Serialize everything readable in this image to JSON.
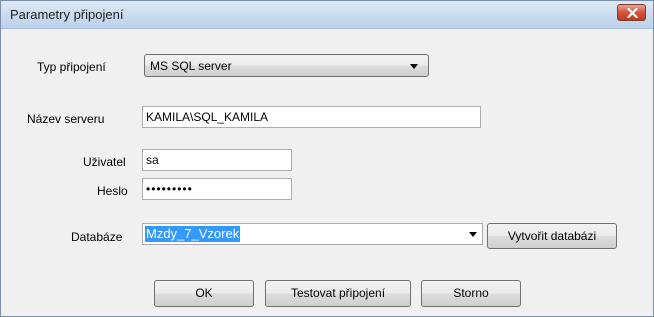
{
  "window": {
    "title": "Parametry připojení"
  },
  "form": {
    "connection_type_label": "Typ připojení",
    "connection_type_value": "MS SQL server",
    "server_name_label": "Název serveru",
    "server_name_value": "KAMILA\\SQL_KAMILA",
    "user_label": "Uživatel",
    "user_value": "sa",
    "password_label": "Heslo",
    "password_value": "•••••••••",
    "database_label": "Databáze",
    "database_value": "Mzdy_7_Vzorek"
  },
  "buttons": {
    "create_db": "Vytvořit databázi",
    "ok": "OK",
    "test": "Testovat připojení",
    "cancel": "Storno"
  },
  "icons": {
    "close": "close-icon",
    "dropdown": "chevron-down-icon"
  },
  "colors": {
    "selection": "#3399ff",
    "close_button": "#c43b20",
    "window_bg": "#f0f0f0"
  }
}
